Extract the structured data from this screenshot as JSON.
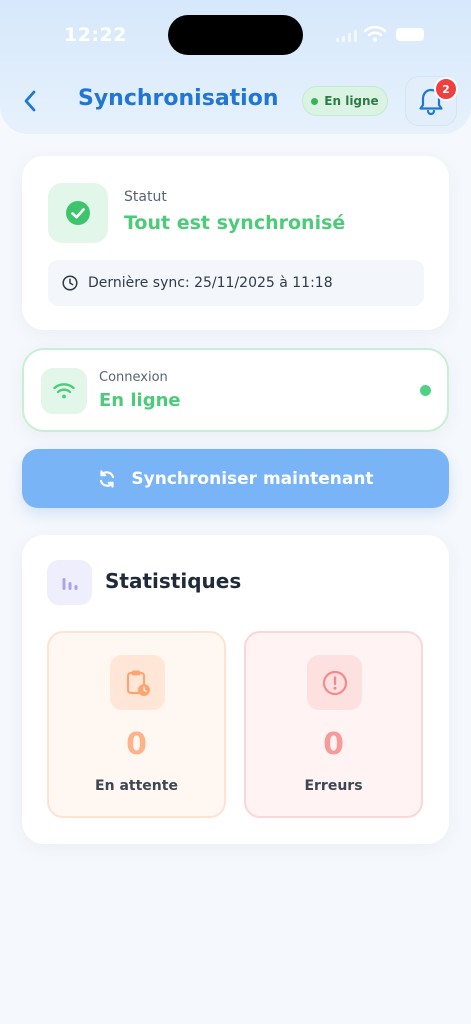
{
  "status_bar": {
    "time": "12:22"
  },
  "header": {
    "title": "Synchronisation",
    "connection_pill": "En ligne",
    "notifications_count": "2"
  },
  "status_card": {
    "label": "Statut",
    "value": "Tout est synchronisé",
    "last_sync": "Dernière sync: 25/11/2025 à 11:18"
  },
  "connection_card": {
    "label": "Connexion",
    "value": "En ligne"
  },
  "sync_button": {
    "label": "Synchroniser maintenant"
  },
  "stats": {
    "title": "Statistiques",
    "pending": {
      "value": "0",
      "label": "En attente"
    },
    "errors": {
      "value": "0",
      "label": "Erreurs"
    }
  },
  "colors": {
    "accent": "#2076d6",
    "success": "#4ccb79",
    "button": "#79b5f6",
    "pending": "#fdb28a",
    "error": "#f79a9a",
    "badge": "#ef4040"
  },
  "icons": {
    "back": "chevron-left-icon",
    "notifications": "bell-icon",
    "status": "check-circle-icon",
    "last_sync": "clock-icon",
    "connection": "wifi-icon",
    "sync": "refresh-icon",
    "stats": "bar-chart-icon",
    "pending": "clipboard-clock-icon",
    "errors": "alert-circle-icon"
  }
}
